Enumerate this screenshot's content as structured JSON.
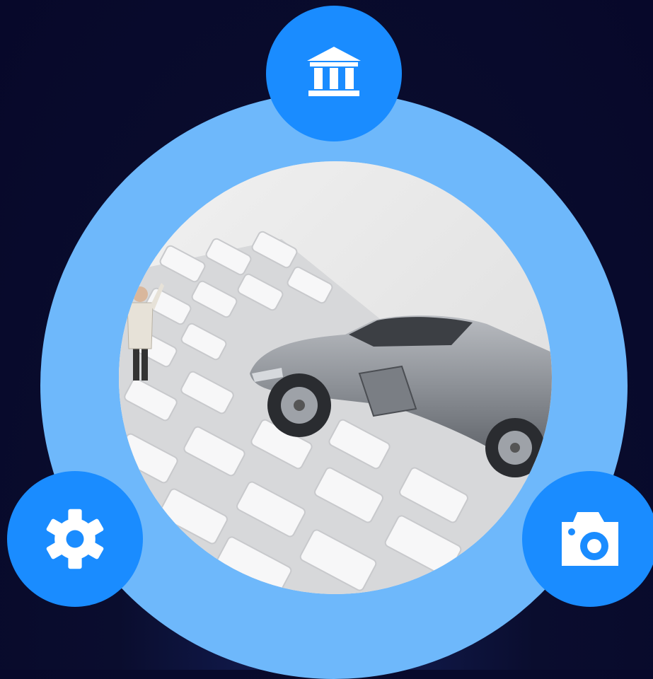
{
  "diagram": {
    "ring_color": "#6eb8fb",
    "node_color": "#1a8cff",
    "background_color": "#0a0d2e",
    "center_image": "miniature-car-accident-on-keyboard-photo",
    "nodes": [
      {
        "position": "top",
        "icon": "bank-icon"
      },
      {
        "position": "bottom-left",
        "icon": "gear-icon"
      },
      {
        "position": "bottom-right",
        "icon": "camera-icon"
      }
    ]
  }
}
